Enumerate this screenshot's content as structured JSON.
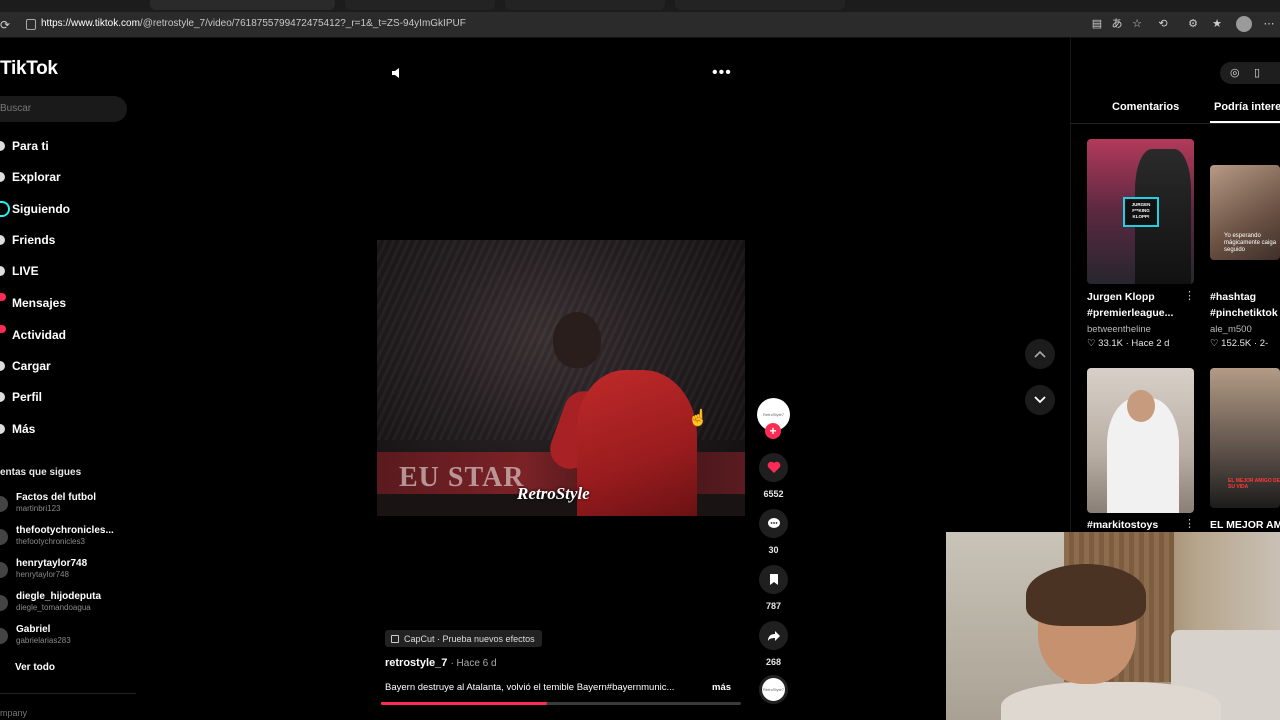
{
  "browser": {
    "url_domain": "https://www.tiktok.com",
    "url_path": "/@retrostyle_7/video/7618755799472475412?_r=1&_t=ZS-94yImGkIPUF"
  },
  "sidebar": {
    "logo": "TikTok",
    "search_placeholder": "Buscar",
    "nav": [
      {
        "label": "Para ti"
      },
      {
        "label": "Explorar"
      },
      {
        "label": "Siguiendo"
      },
      {
        "label": "Friends"
      },
      {
        "label": "LIVE"
      },
      {
        "label": "Mensajes"
      },
      {
        "label": "Actividad"
      },
      {
        "label": "Cargar"
      },
      {
        "label": "Perfil"
      },
      {
        "label": "Más"
      }
    ],
    "following_title": "entas que sigues",
    "accounts": [
      {
        "name": "Factos del futbol",
        "handle": "martinbri123"
      },
      {
        "name": "thefootychronicles...",
        "handle": "thefootychronicles3"
      },
      {
        "name": "henrytaylor748",
        "handle": "henrytaylor748"
      },
      {
        "name": "diegle_hijodeputa",
        "handle": "diegle_tomandoagua"
      },
      {
        "name": "Gabriel",
        "handle": "gabrielarias283"
      }
    ],
    "see_all": "Ver todo",
    "footer": "mpany"
  },
  "video": {
    "watermark": "RetroStyle",
    "banner_text": "EU STAR",
    "author_avatar_text": "RetroStyle7",
    "likes": "6552",
    "comments": "30",
    "saves": "787",
    "shares": "268",
    "progress": 0.46,
    "capcut_label": "CapCut · Prueba nuevos efectos",
    "author": "retrostyle_7",
    "time": "· Hace 6 d",
    "description": "Bayern destruye al Atalanta, volvió el temible Bayern#bayernmunic...",
    "more_label": "más"
  },
  "right_panel": {
    "tab_comments": "Comentarios",
    "tab_recommended": "Podría intere",
    "videos": [
      {
        "title_line1": "Jurgen Klopp",
        "title_line2": "#premierleague...",
        "author": "betweentheline",
        "stats": "♡ 33.1K · Hace 2 d",
        "thumb_caption": "JURGEN F**KING KLOPP!"
      },
      {
        "title_line1": "#hashtag",
        "title_line2": "#pinchetiktok",
        "author": "ale_m500",
        "stats": "♡ 152.5K · 2-",
        "thumb_caption": "Yo esperando mágicamente caiga seguido"
      },
      {
        "title_line1": "#markitostoys",
        "author": ""
      },
      {
        "title_line1": "EL MEJOR AM",
        "thumb_caption": "EL MEJOR AMIGO DE SU VIDA"
      }
    ]
  },
  "colors": {
    "accent": "#fe2c55",
    "background": "#000000"
  }
}
